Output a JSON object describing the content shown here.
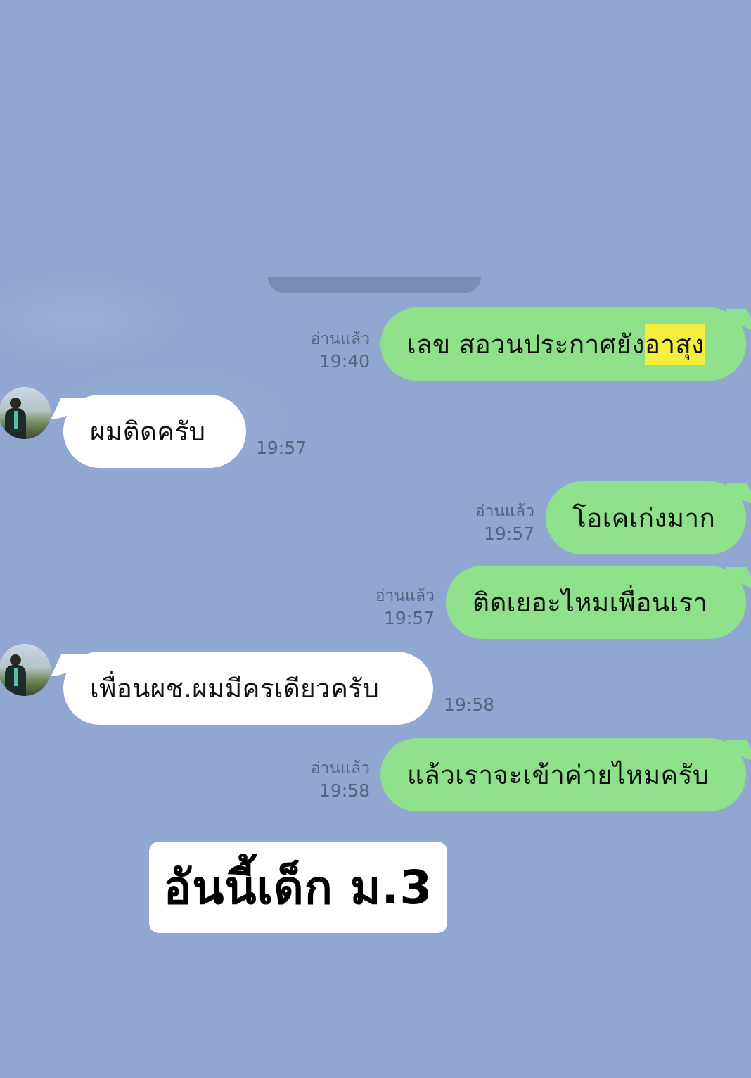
{
  "colors": {
    "background": "#90a7d1",
    "outgoing_bubble": "#8fe08a",
    "incoming_bubble": "#ffffff",
    "highlight": "#f6ee3f",
    "meta_text": "#56647f"
  },
  "messages": [
    {
      "direction": "out",
      "text_plain": "เลข สอวนประกาศยัง",
      "text_highlight": "อาสุง",
      "read": "อ่านแล้ว",
      "time": "19:40"
    },
    {
      "direction": "in",
      "text": "ผมติดครับ",
      "time": "19:57",
      "avatar": "profile-photo"
    },
    {
      "direction": "out",
      "text": "โอเคเก่งมาก",
      "read": "อ่านแล้ว",
      "time": "19:57"
    },
    {
      "direction": "out",
      "text": "ติดเยอะไหมเพื่อนเรา",
      "read": "อ่านแล้ว",
      "time": "19:57"
    },
    {
      "direction": "in",
      "text": "เพื่อนผช.ผมมีครเดียวครับ",
      "time": "19:58",
      "avatar": "profile-photo"
    },
    {
      "direction": "out",
      "text": "แล้วเราจะเข้าค่ายไหมครับ",
      "read": "อ่านแล้ว",
      "time": "19:58"
    }
  ],
  "caption": "อันนี้เด็ก ม.3"
}
